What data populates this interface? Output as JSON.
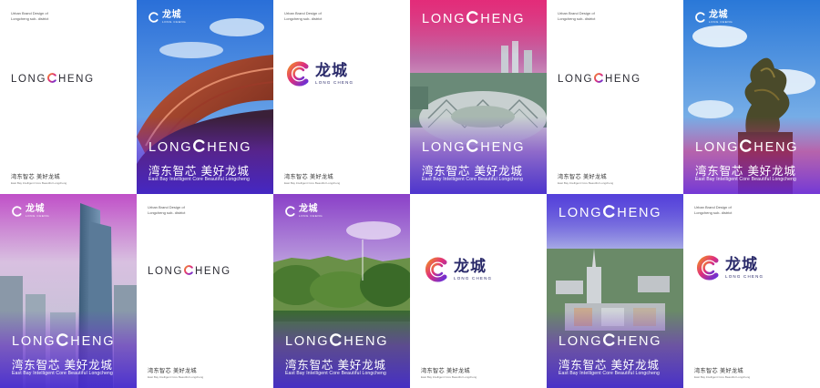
{
  "brand": {
    "wordmark_pre": "LONG",
    "wordmark_post": "HENG",
    "logo_cn": "龙城",
    "logo_en": "LONG CHENG",
    "note": "Urban Brand Design of\nLongcheng sub- district",
    "slogan_cn": "湾东智芯 美好龙城",
    "slogan_en": "East Bay Intelligent Core  Beautiful Longcheng",
    "footer_cn": "湾东智芯 美好龙城",
    "footer_en": "East Bay Intelligent Core  Beautiful Longcheng"
  },
  "colors": {
    "brand_purple": "#6a2fd6",
    "brand_blue": "#2d3de0",
    "brand_magenta": "#e0307a",
    "brand_orange": "#f08a2a"
  },
  "tiles": [
    {
      "type": "white-wordmark"
    },
    {
      "type": "photo-roof",
      "icon": "roof-photo"
    },
    {
      "type": "white-logo"
    },
    {
      "type": "photo-stadium",
      "icon": "stadium-photo"
    },
    {
      "type": "white-wordmark"
    },
    {
      "type": "photo-dragon",
      "icon": "dragon-sculpture-photo"
    },
    {
      "type": "photo-towers",
      "icon": "towers-photo"
    },
    {
      "type": "white-wordmark"
    },
    {
      "type": "photo-lake",
      "icon": "lake-photo"
    },
    {
      "type": "white-logo-center"
    },
    {
      "type": "photo-campus",
      "icon": "campus-photo"
    },
    {
      "type": "white-logo"
    }
  ]
}
